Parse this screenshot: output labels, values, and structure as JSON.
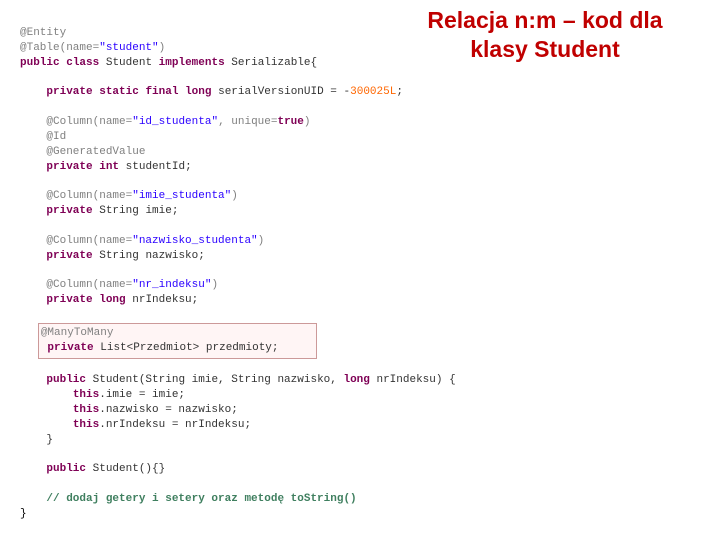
{
  "title_line1": "Relacja n:m – kod dla",
  "title_line2": "klasy Student",
  "code": {
    "ann_entity": "@Entity",
    "ann_table_open": "@Table(name=",
    "ann_table_val": "\"student\"",
    "ann_table_close": ")",
    "kw_public": "public",
    "kw_class": "class",
    "tok_classname": "Student",
    "kw_implements": "implements",
    "tok_serial": "Serializable{",
    "kw_private": "private",
    "kw_static": "static",
    "kw_final": "final",
    "kw_long": "long",
    "tok_svuid": "serialVersionUID = -",
    "num_svuid": "300025L",
    "semi": ";",
    "ann_col_open": "@Column(name=",
    "ann_col_id_val": "\"id_studenta\"",
    "ann_col_sep": ", unique=",
    "kw_true": "true",
    "ann_col_close": ")",
    "ann_id": "@Id",
    "ann_gen": "@GeneratedValue",
    "kw_int": "int",
    "tok_sid": "studentId",
    "ann_col_imie_val": "\"imie_studenta\"",
    "tok_string": "String",
    "tok_imie": "imie",
    "ann_col_nazw_val": "\"nazwisko_studenta\"",
    "tok_nazw": "nazwisko",
    "ann_col_nr_val": "\"nr_indeksu\"",
    "tok_nrI": "nrIndeksu",
    "ann_m2m": "@ManyToMany",
    "tok_list_open": "List<Przedmiot>",
    "tok_przedmioty": "przedmioty",
    "tok_ctor_sig1": "Student(String imie",
    "tok_ctor_sig2": ", String nazwisko",
    "tok_ctor_sig3": ", ",
    "tok_ctor_sig4": " nrIndeksu) {",
    "kw_this": "this",
    "tok_assign_imie": ".imie = imie;",
    "tok_assign_nazw": ".nazwisko = nazwisko;",
    "tok_assign_nr": ".nrIndeksu = nrIndeksu;",
    "tok_rbrace": "}",
    "tok_ctor2": "Student(){}",
    "comment": "// dodaj getery i setery oraz metodę toString()"
  }
}
